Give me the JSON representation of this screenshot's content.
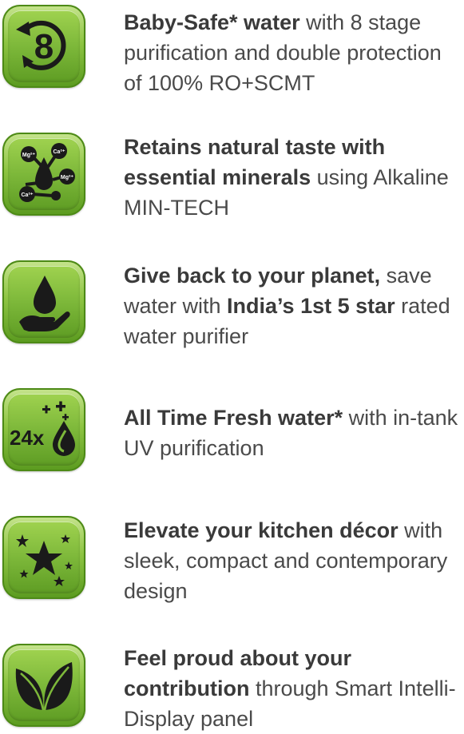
{
  "features": [
    {
      "icon": "eight-stage-purification-icon",
      "icon_text": "8",
      "parts": [
        {
          "t": "Baby-Safe* water",
          "b": true
        },
        {
          "t": " with 8 stage purification and double protection of 100% RO+SCMT",
          "b": false
        }
      ]
    },
    {
      "icon": "minerals-droplet-icon",
      "icon_labels": [
        "Mg²⁺",
        "Ca²⁺",
        "Mg²⁺",
        "Ca²⁺"
      ],
      "parts": [
        {
          "t": "Retains natural taste with essential minerals",
          "b": true
        },
        {
          "t": " using Alkaline MIN-TECH",
          "b": false
        }
      ]
    },
    {
      "icon": "water-drop-hand-icon",
      "parts": [
        {
          "t": "Give back to your planet,",
          "b": true
        },
        {
          "t": " save water with ",
          "b": false
        },
        {
          "t": "India’s 1st 5 star",
          "b": true
        },
        {
          "t": " rated water purifier",
          "b": false
        }
      ]
    },
    {
      "icon": "uv-fresh-24x-icon",
      "icon_text": "24x",
      "parts": [
        {
          "t": "All Time Fresh water*",
          "b": true
        },
        {
          "t": " with in-tank UV purification",
          "b": false
        }
      ]
    },
    {
      "icon": "stars-icon",
      "parts": [
        {
          "t": "Elevate your kitchen décor",
          "b": true
        },
        {
          "t": " with sleek, compact and contemporary design",
          "b": false
        }
      ]
    },
    {
      "icon": "leaves-icon",
      "parts": [
        {
          "t": "Feel proud about your contribution",
          "b": true
        },
        {
          "t": " through Smart Intelli-Display panel",
          "b": false
        }
      ]
    }
  ],
  "colors": {
    "tile_light": "#c6e48e",
    "tile_dark": "#5a9a1f",
    "text": "#4a4a4a",
    "icon_fg": "#1a1a1a"
  }
}
